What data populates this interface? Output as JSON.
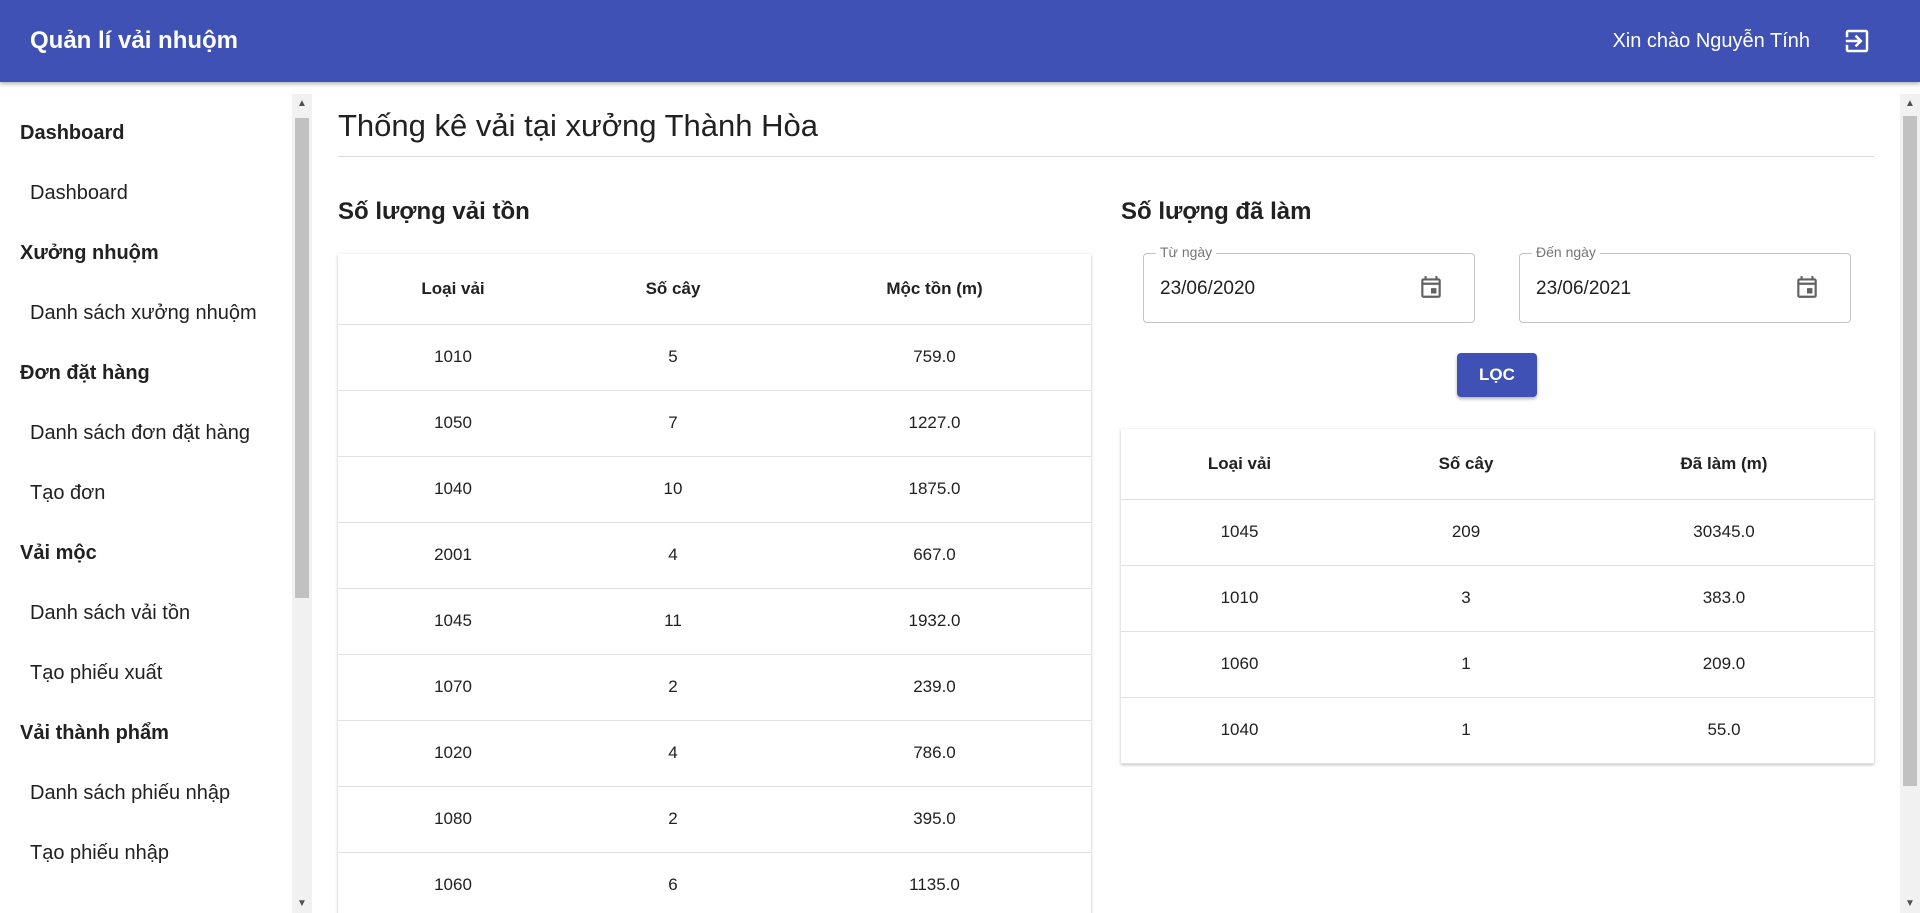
{
  "header": {
    "title": "Quản lí vải nhuộm",
    "greeting": "Xin chào Nguyễn Tính",
    "logout_icon": "logout-icon"
  },
  "sidebar": {
    "sections": [
      {
        "header": "Dashboard",
        "items": [
          "Dashboard"
        ]
      },
      {
        "header": "Xưởng nhuộm",
        "items": [
          "Danh sách xưởng nhuộm"
        ]
      },
      {
        "header": "Đơn đặt hàng",
        "items": [
          "Danh sách đơn đặt hàng",
          "Tạo đơn"
        ]
      },
      {
        "header": "Vải mộc",
        "items": [
          "Danh sách vải tồn",
          "Tạo phiếu xuất"
        ]
      },
      {
        "header": "Vải thành phẩm",
        "items": [
          "Danh sách phiếu nhập",
          "Tạo phiếu nhập"
        ]
      }
    ]
  },
  "page": {
    "title": "Thống kê vải tại xưởng Thành Hòa"
  },
  "inventory": {
    "title": "Số lượng vải tồn",
    "columns": [
      "Loại vải",
      "Số cây",
      "Mộc tồn (m)"
    ],
    "rows": [
      [
        "1010",
        "5",
        "759.0"
      ],
      [
        "1050",
        "7",
        "1227.0"
      ],
      [
        "1040",
        "10",
        "1875.0"
      ],
      [
        "2001",
        "4",
        "667.0"
      ],
      [
        "1045",
        "11",
        "1932.0"
      ],
      [
        "1070",
        "2",
        "239.0"
      ],
      [
        "1020",
        "4",
        "786.0"
      ],
      [
        "1080",
        "2",
        "395.0"
      ],
      [
        "1060",
        "6",
        "1135.0"
      ]
    ]
  },
  "completed": {
    "title": "Số lượng đã làm",
    "from_label": "Từ ngày",
    "from_value": "23/06/2020",
    "to_label": "Đến ngày",
    "to_value": "23/06/2021",
    "filter_label": "LỌC",
    "columns": [
      "Loại vải",
      "Số cây",
      "Đã làm (m)"
    ],
    "rows": [
      [
        "1045",
        "209",
        "30345.0"
      ],
      [
        "1010",
        "3",
        "383.0"
      ],
      [
        "1060",
        "1",
        "209.0"
      ],
      [
        "1040",
        "1",
        "55.0"
      ]
    ]
  },
  "colors": {
    "primary": "#3f51b5"
  }
}
